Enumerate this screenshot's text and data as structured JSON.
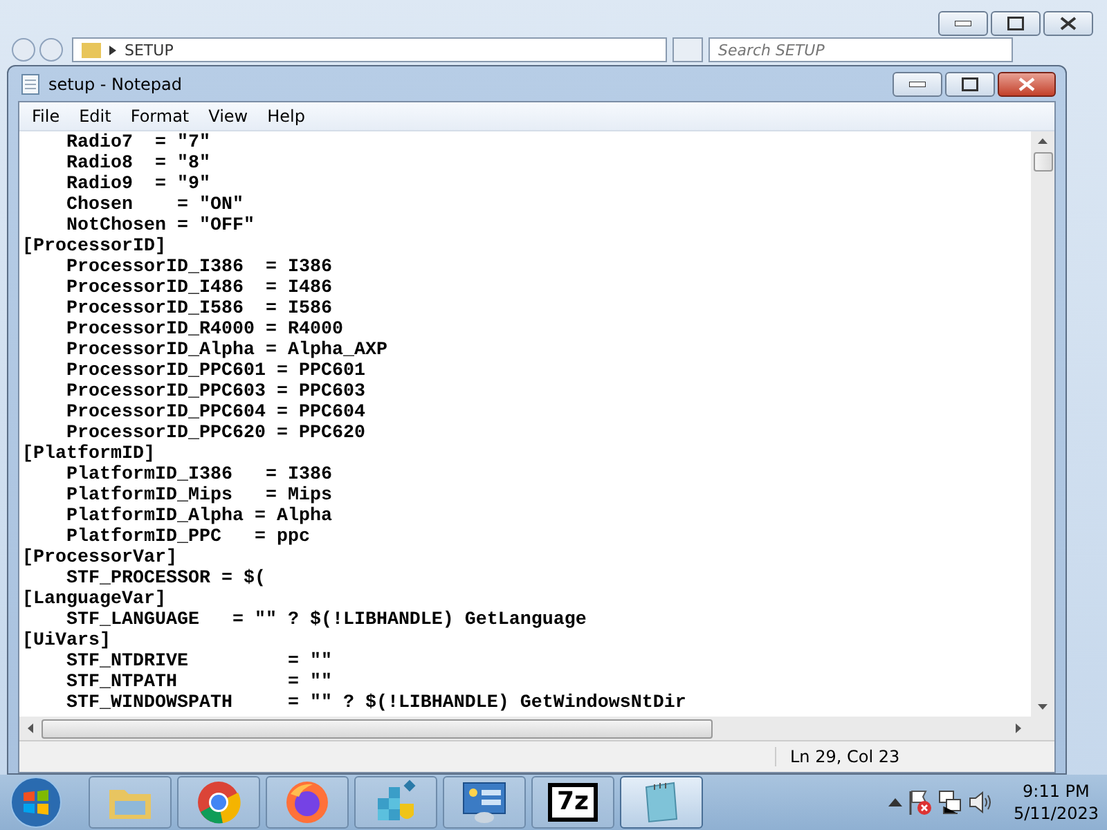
{
  "explorer": {
    "address": "SETUP",
    "search": {
      "placeholder": "Search SETUP"
    }
  },
  "window": {
    "title": "setup - Notepad"
  },
  "menu": [
    "File",
    "Edit",
    "Format",
    "View",
    "Help"
  ],
  "lines": [
    "    Radio7  = \"7\"",
    "    Radio8  = \"8\"",
    "    Radio9  = \"9\"",
    "    Chosen    = \"ON\"",
    "    NotChosen = \"OFF\"",
    "[ProcessorID]",
    "    ProcessorID_I386  = I386",
    "    ProcessorID_I486  = I486",
    "    ProcessorID_I586  = I586",
    "    ProcessorID_R4000 = R4000",
    "    ProcessorID_Alpha = Alpha_AXP",
    "    ProcessorID_PPC601 = PPC601",
    "    ProcessorID_PPC603 = PPC603",
    "    ProcessorID_PPC604 = PPC604",
    "    ProcessorID_PPC620 = PPC620",
    "[PlatformID]",
    "    PlatformID_I386   = I386",
    "    PlatformID_Mips   = Mips",
    "    PlatformID_Alpha = Alpha",
    "    PlatformID_PPC   = ppc",
    "[ProcessorVar]",
    "    STF_PROCESSOR = $(",
    "[LanguageVar]",
    "    STF_LANGUAGE   = \"\" ? $(!LIBHANDLE) GetLanguage",
    "[UiVars]",
    "    STF_NTDRIVE         = \"\"",
    "    STF_NTPATH          = \"\"",
    "    STF_WINDOWSPATH     = \"\" ? $(!LIBHANDLE) GetWindowsNtDir"
  ],
  "status_bar": "Ln 29, Col 23",
  "taskbar": {
    "apps": [
      {
        "kind": "folder",
        "selected": false
      },
      {
        "kind": "chrome",
        "selected": false
      },
      {
        "kind": "firefox",
        "selected": false
      },
      {
        "kind": "cubes",
        "selected": false
      },
      {
        "kind": "panel",
        "selected": false
      },
      {
        "kind": "sevenzip",
        "label": "7z",
        "selected": false
      },
      {
        "kind": "notepad",
        "selected": true
      }
    ],
    "time": "9:11 PM",
    "date": "5/11/2023"
  }
}
